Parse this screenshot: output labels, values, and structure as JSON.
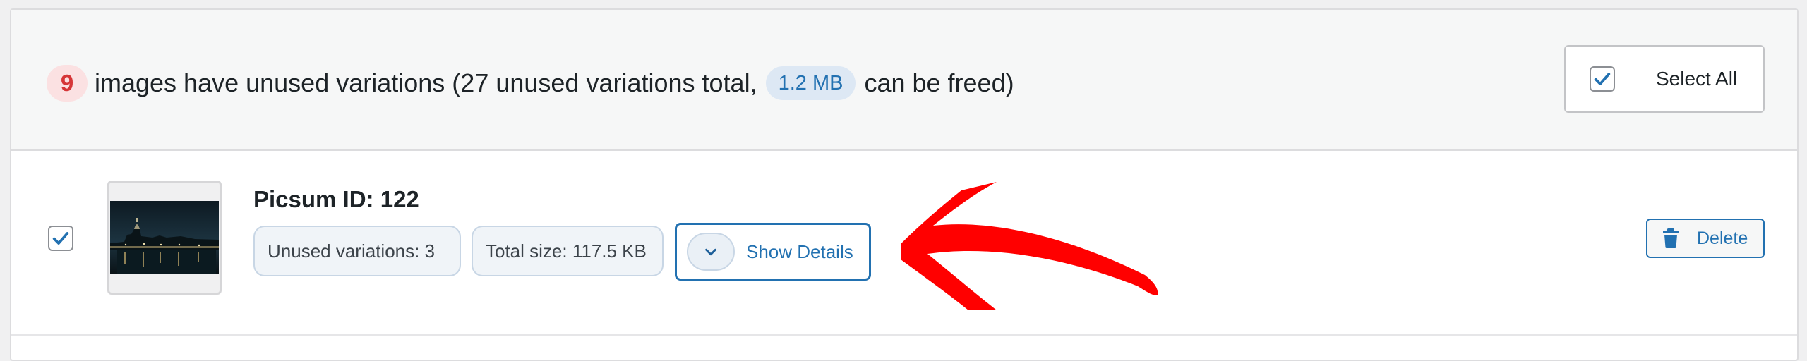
{
  "summary": {
    "count": "9",
    "text_before": "images have unused variations (27 unused variations total,",
    "size": "1.2 MB",
    "text_after": "can be freed)"
  },
  "select_all": {
    "label": "Select All",
    "checked": true
  },
  "item": {
    "checked": true,
    "title": "Picsum ID: 122",
    "unused_variations": "Unused variations: 3",
    "total_size": "Total size: 117.5 KB",
    "show_details_label": "Show Details",
    "delete_label": "Delete"
  },
  "icons": {
    "select_all": "checkmark-icon",
    "row_checkbox": "checkmark-icon",
    "show_details": "chevron-down-icon",
    "delete": "trash-icon",
    "annotation": "red-arrow-annotation"
  },
  "colors": {
    "accent": "#2271b1",
    "count_badge_bg": "#fbe1e2",
    "count_badge_fg": "#d63638",
    "arrow": "#ff0000"
  }
}
